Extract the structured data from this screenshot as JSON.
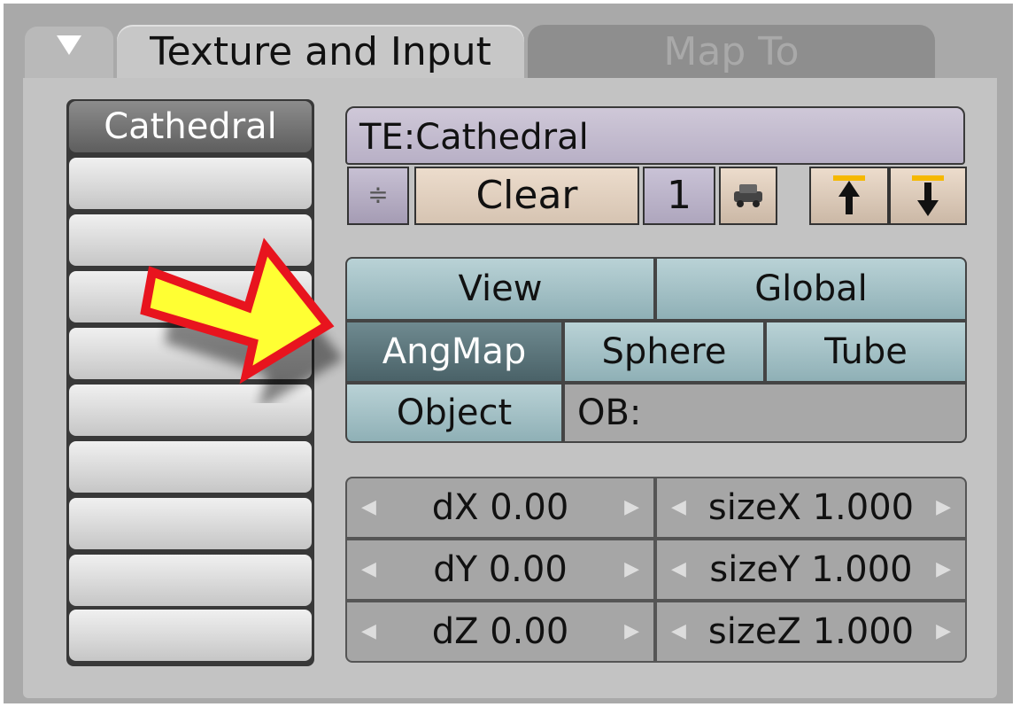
{
  "header": {
    "tabs": [
      {
        "label": "Texture and Input",
        "active": true
      },
      {
        "label": "Map To",
        "active": false
      }
    ]
  },
  "channels": {
    "items": [
      "Cathedral",
      "",
      "",
      "",
      "",
      "",
      "",
      "",
      "",
      ""
    ],
    "active_index": 0
  },
  "texture": {
    "name": "TE:Cathedral",
    "clear_label": "Clear",
    "users": "1"
  },
  "mapping": {
    "view_label": "View",
    "global_label": "Global",
    "angmap_label": "AngMap",
    "sphere_label": "Sphere",
    "tube_label": "Tube",
    "object_label": "Object",
    "ob_label": "OB:",
    "selected": "AngMap"
  },
  "offset_size": {
    "dx": "dX 0.00",
    "dy": "dY 0.00",
    "dz": "dZ 0.00",
    "sizex": "sizeX 1.000",
    "sizey": "sizeY 1.000",
    "sizez": "sizeZ 1.000"
  },
  "colors": {
    "annotation_arrow_fill": "#ffff33",
    "annotation_arrow_stroke": "#e8141e",
    "selected_button": "#56707a",
    "mapping_button": "#a6c3c8"
  }
}
